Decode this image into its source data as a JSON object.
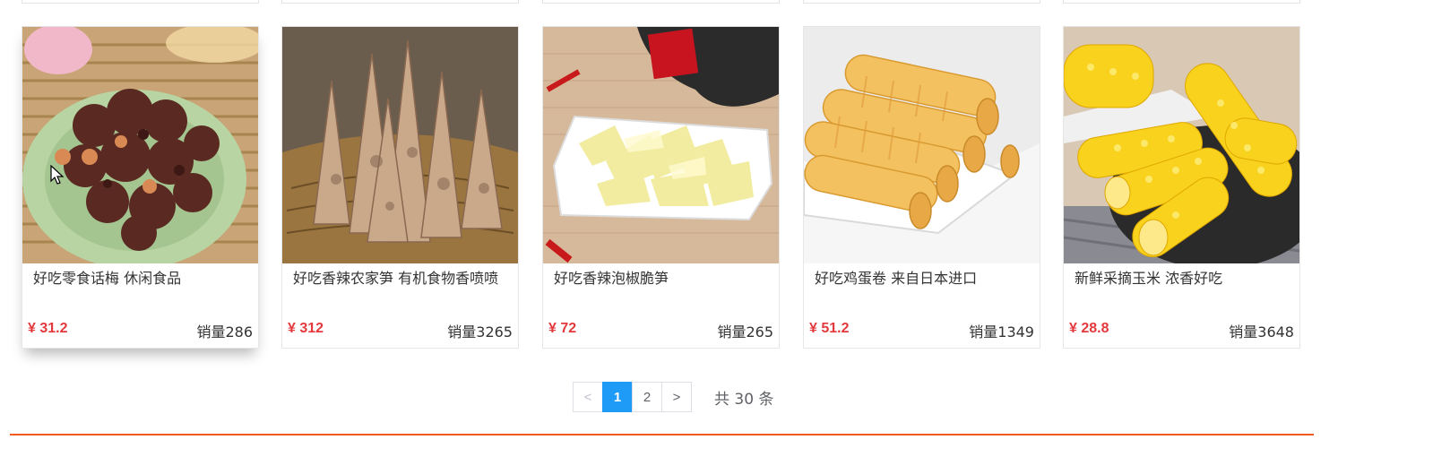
{
  "products": [
    {
      "title": "好吃零食话梅 休闲食品",
      "price": "¥ 31.2",
      "sales": "销量286",
      "image": "dried-plums-photo"
    },
    {
      "title": "好吃香辣农家笋 有机食物香喷喷",
      "price": "¥ 312",
      "sales": "销量3265",
      "image": "bamboo-shoots-basket-photo"
    },
    {
      "title": "好吃香辣泡椒脆笋",
      "price": "¥ 72",
      "sales": "销量265",
      "image": "pickled-bamboo-shoots-photo"
    },
    {
      "title": "好吃鸡蛋卷 来自日本进口",
      "price": "¥ 51.2",
      "sales": "销量1349",
      "image": "egg-rolls-photo"
    },
    {
      "title": "新鲜采摘玉米 浓香好吃",
      "price": "¥ 28.8",
      "sales": "销量3648",
      "image": "fresh-corn-photo"
    }
  ],
  "pagination": {
    "prev": "<",
    "pages": [
      "1",
      "2"
    ],
    "current": "1",
    "next": ">",
    "total_text": "共 30 条"
  },
  "colors": {
    "price": "#e4393c",
    "active_page": "#1d9bf7",
    "footer_line": "#f25a1e"
  }
}
